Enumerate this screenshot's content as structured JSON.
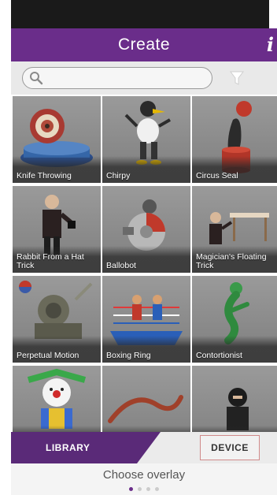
{
  "header": {
    "title": "Create",
    "info_symbol": "i"
  },
  "search": {
    "value": "",
    "placeholder": ""
  },
  "tiles": [
    {
      "label": "Knife Throwing",
      "icon": "knife-wheel"
    },
    {
      "label": "Chirpy",
      "icon": "bird-robot"
    },
    {
      "label": "Circus Seal",
      "icon": "seal"
    },
    {
      "label": "Rabbit From a Hat Trick",
      "icon": "magician"
    },
    {
      "label": "Ballobot",
      "icon": "ball-robot"
    },
    {
      "label": "Magician's Floating Trick",
      "icon": "floating"
    },
    {
      "label": "Perpetual Motion",
      "icon": "machine"
    },
    {
      "label": "Boxing Ring",
      "icon": "boxing-ring"
    },
    {
      "label": "Contortionist",
      "icon": "contortionist"
    },
    {
      "label": "",
      "icon": "clown"
    },
    {
      "label": "",
      "icon": "whip"
    },
    {
      "label": "",
      "icon": "ninja"
    }
  ],
  "tabs": {
    "library": "LIBRARY",
    "device": "DEVICE"
  },
  "footer": {
    "hint": "Choose overlay"
  },
  "colors": {
    "brand": "#6a2d8a",
    "tab_active": "#5a2a78"
  }
}
